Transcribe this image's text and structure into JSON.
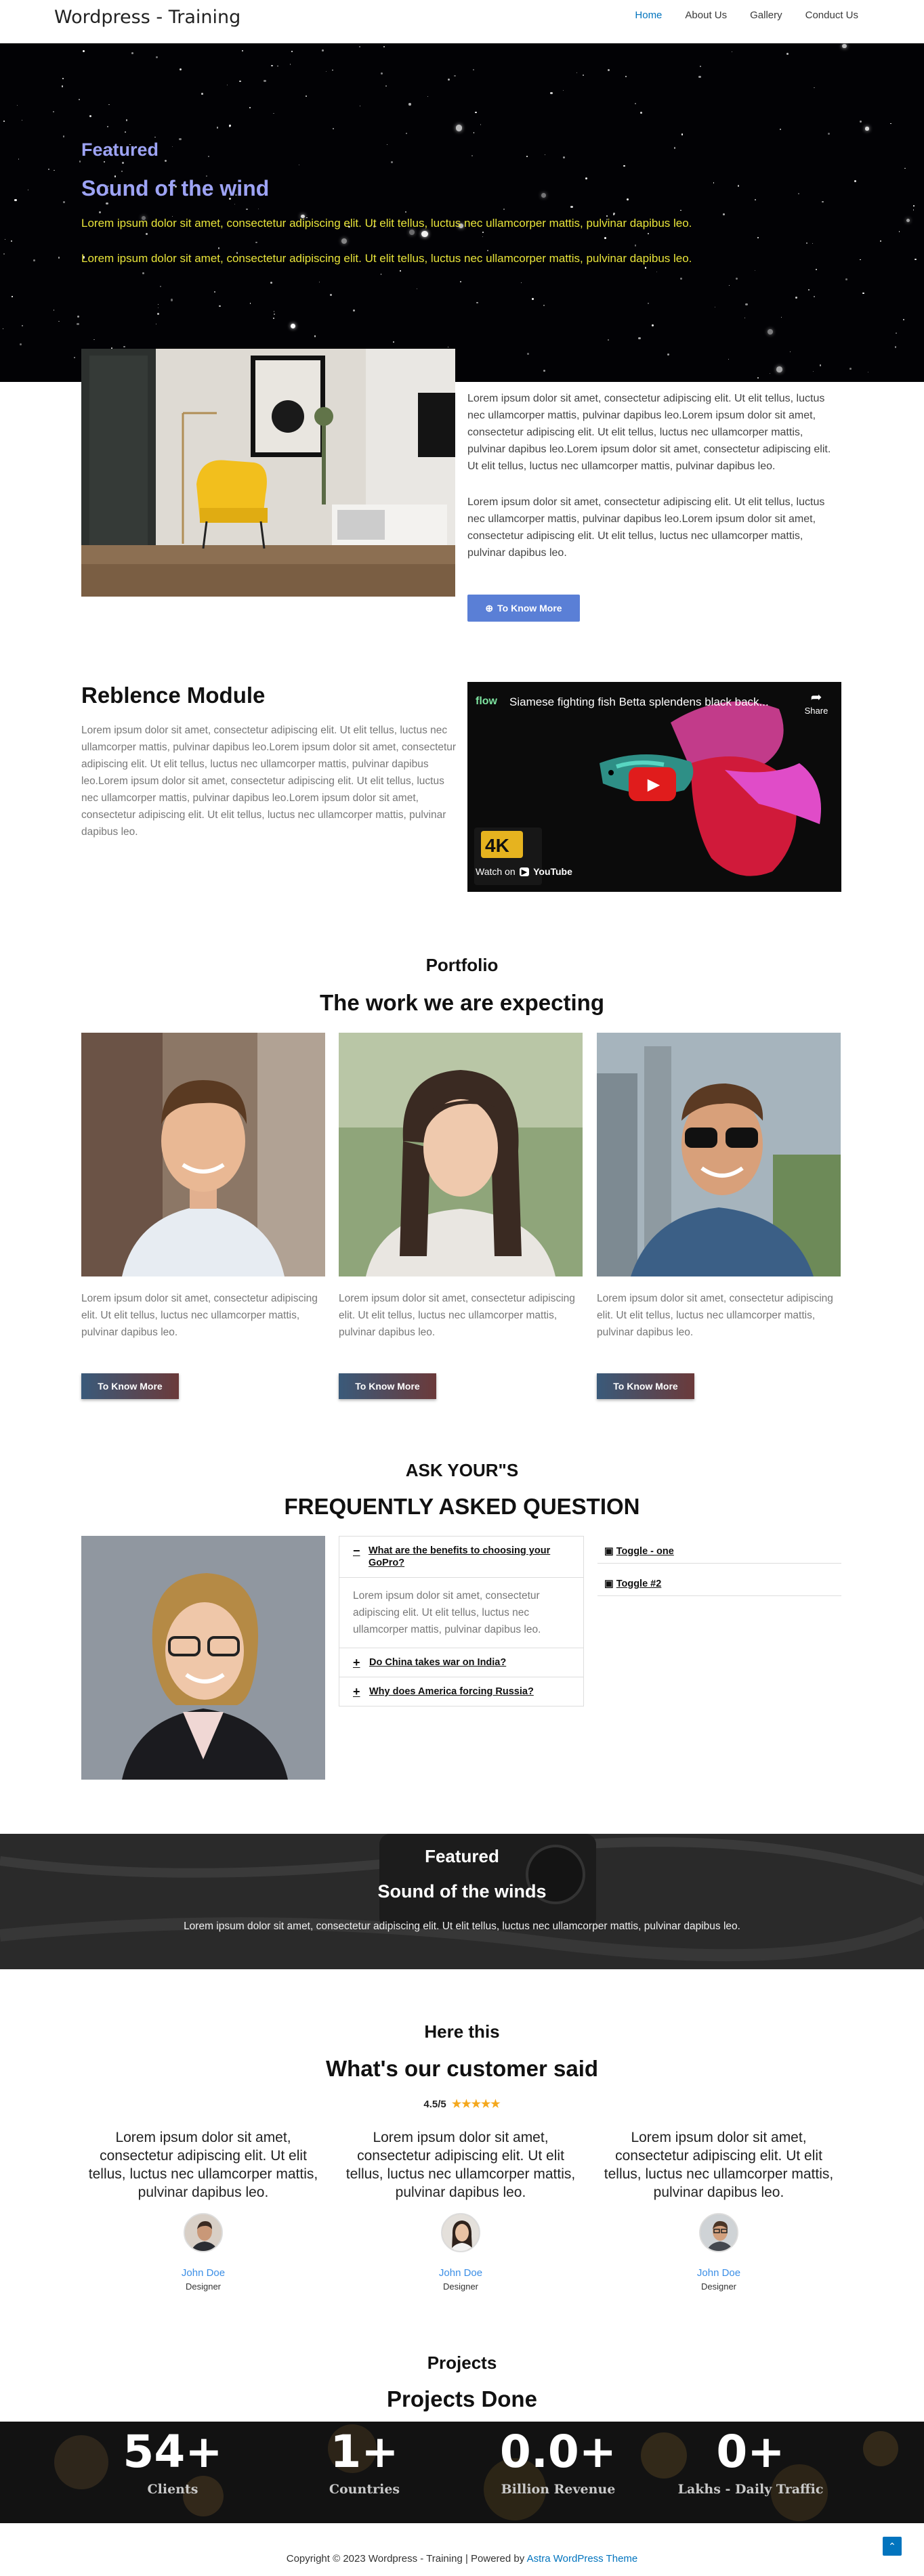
{
  "header": {
    "site_title": "Wordpress - Training",
    "nav": [
      "Home",
      "About Us",
      "Gallery",
      "Conduct Us"
    ]
  },
  "hero": {
    "featured": "Featured",
    "title": "Sound of the wind",
    "p1": "Lorem ipsum dolor sit amet, consectetur adipiscing elit. Ut elit tellus, luctus nec ullamcorper mattis, pulvinar dapibus leo.",
    "p2": "Lorem ipsum dolor sit amet, consectetur adipiscing elit. Ut elit tellus, luctus nec ullamcorper mattis, pulvinar dapibus leo."
  },
  "intro": {
    "p1": "Lorem ipsum dolor sit amet, consectetur adipiscing elit. Ut elit tellus, luctus nec ullamcorper mattis, pulvinar dapibus leo.Lorem ipsum dolor sit amet, consectetur adipiscing elit. Ut elit tellus, luctus nec ullamcorper mattis, pulvinar dapibus leo.Lorem ipsum dolor sit amet, consectetur adipiscing elit. Ut elit tellus, luctus nec ullamcorper mattis, pulvinar dapibus leo.",
    "p2": "Lorem ipsum dolor sit amet, consectetur adipiscing elit. Ut elit tellus, luctus nec ullamcorper mattis, pulvinar dapibus leo.Lorem ipsum dolor sit amet, consectetur adipiscing elit. Ut elit tellus, luctus nec ullamcorper mattis, pulvinar dapibus leo.",
    "button": "To Know More"
  },
  "reblence": {
    "title": "Reblence Module",
    "text": "Lorem ipsum dolor sit amet, consectetur adipiscing elit. Ut elit tellus, luctus nec ullamcorper mattis, pulvinar dapibus leo.Lorem ipsum dolor sit amet, consectetur adipiscing elit. Ut elit tellus, luctus nec ullamcorper mattis, pulvinar dapibus leo.Lorem ipsum dolor sit amet, consectetur adipiscing elit. Ut elit tellus, luctus nec ullamcorper mattis, pulvinar dapibus leo.Lorem ipsum dolor sit amet, consectetur adipiscing elit. Ut elit tellus, luctus nec ullamcorper mattis, pulvinar dapibus leo.",
    "video": {
      "channel": "flow",
      "title": "Siamese fighting fish Betta splendens black back...",
      "share": "Share",
      "watch_on": "Watch on",
      "youtube": "YouTube",
      "badge": "4K"
    }
  },
  "portfolio": {
    "subtitle": "Portfolio",
    "title": "The work we are expecting",
    "items": [
      {
        "text": "Lorem ipsum dolor sit amet, consectetur adipiscing elit. Ut elit tellus, luctus nec ullamcorper mattis, pulvinar dapibus leo.",
        "button": "To Know More"
      },
      {
        "text": "Lorem ipsum dolor sit amet, consectetur adipiscing elit. Ut elit tellus, luctus nec ullamcorper mattis, pulvinar dapibus leo.",
        "button": "To Know More"
      },
      {
        "text": "Lorem ipsum dolor sit amet, consectetur adipiscing elit. Ut elit tellus, luctus nec ullamcorper mattis, pulvinar dapibus leo.",
        "button": "To Know More"
      }
    ]
  },
  "faq": {
    "subtitle": "ASK YOUR\"S",
    "title": "FREQUENTLY ASKED QUESTION",
    "accordion": [
      {
        "sign": "−",
        "question": "What are the benefits to choosing your GoPro?",
        "answer": "Lorem ipsum dolor sit amet, consectetur adipiscing elit. Ut elit tellus, luctus nec ullamcorper mattis, pulvinar dapibus leo."
      },
      {
        "sign": "+",
        "question": "Do China takes war on India?"
      },
      {
        "sign": "+",
        "question": "Why does America forcing Russia?"
      }
    ],
    "toggles": [
      "Toggle - one",
      "Toggle #2"
    ]
  },
  "featured2": {
    "featured": "Featured",
    "title": "Sound of the winds",
    "text": "Lorem ipsum dolor sit amet, consectetur adipiscing elit. Ut elit tellus, luctus nec ullamcorper mattis, pulvinar dapibus leo."
  },
  "testimonials": {
    "subtitle": "Here this",
    "title": "What's our customer said",
    "rating": "4.5/5",
    "rating_value": 4.5,
    "items": [
      {
        "quote": "Lorem ipsum dolor sit amet, consectetur adipiscing elit. Ut elit tellus, luctus nec ullamcorper mattis, pulvinar dapibus leo.",
        "name": "John Doe",
        "role": "Designer"
      },
      {
        "quote": "Lorem ipsum dolor sit amet, consectetur adipiscing elit. Ut elit tellus, luctus nec ullamcorper mattis, pulvinar dapibus leo.",
        "name": "John Doe",
        "role": "Designer"
      },
      {
        "quote": "Lorem ipsum dolor sit amet, consectetur adipiscing elit. Ut elit tellus, luctus nec ullamcorper mattis, pulvinar dapibus leo.",
        "name": "John Doe",
        "role": "Designer"
      }
    ]
  },
  "projects": {
    "subtitle": "Projects",
    "title": "Projects Done",
    "stats": [
      {
        "value": "54+",
        "label": "Clients"
      },
      {
        "value": "1+",
        "label": "Countries"
      },
      {
        "value": "0.0+",
        "label": "Billion Revenue"
      },
      {
        "value": "0+",
        "label": "Lakhs - Daily Traffic"
      }
    ]
  },
  "footer": {
    "copyright": "Copyright © 2023 Wordpress - Training | Powered by ",
    "theme_link": "Astra WordPress Theme"
  },
  "colors": {
    "accent": "#0274be",
    "hero_title": "#9da3f4",
    "hero_text": "#e8e43a",
    "button_blue": "#5a7fd6"
  }
}
